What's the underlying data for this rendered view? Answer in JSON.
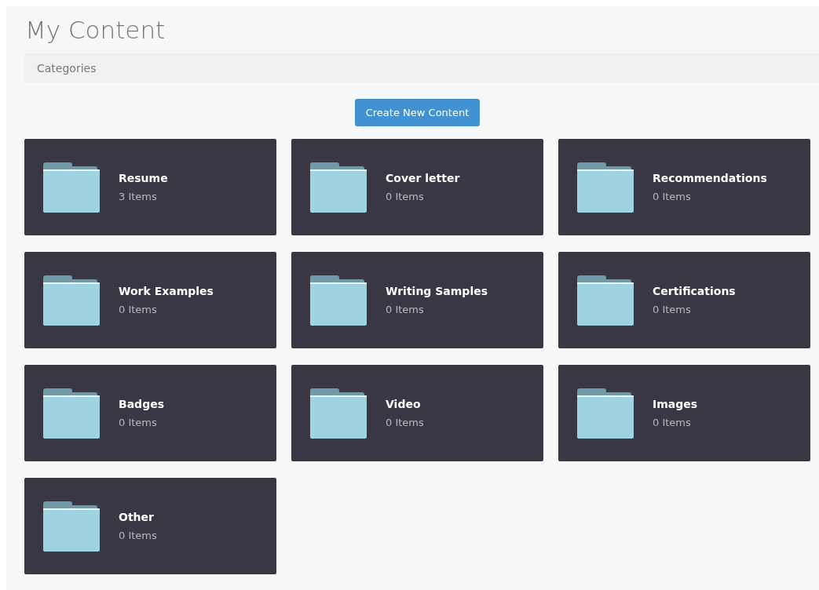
{
  "title": "My Content",
  "categories_bar": {
    "label": "Categories"
  },
  "create_button": {
    "label": "Create New Content"
  },
  "folders": [
    {
      "name": "Resume",
      "count": "3 Items"
    },
    {
      "name": "Cover letter",
      "count": "0 Items"
    },
    {
      "name": "Recommendations",
      "count": "0 Items"
    },
    {
      "name": "Work Examples",
      "count": "0 Items"
    },
    {
      "name": "Writing Samples",
      "count": "0 Items"
    },
    {
      "name": "Certifications",
      "count": "0 Items"
    },
    {
      "name": "Badges",
      "count": "0 Items"
    },
    {
      "name": "Video",
      "count": "0 Items"
    },
    {
      "name": "Images",
      "count": "0 Items"
    },
    {
      "name": "Other",
      "count": "0 Items"
    }
  ]
}
